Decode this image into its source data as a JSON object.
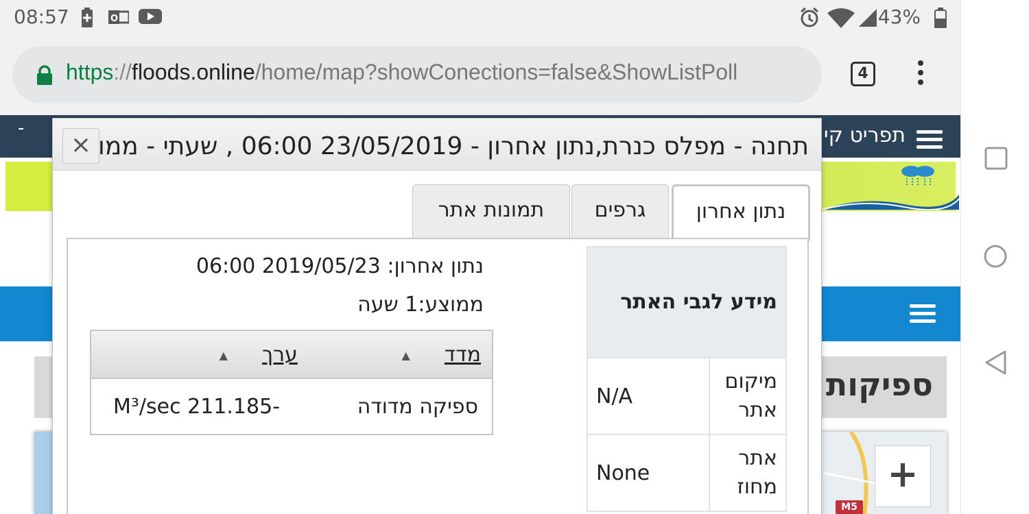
{
  "status_bar": {
    "time": "08:57",
    "battery": "43%",
    "icons": [
      "battery-saver-icon",
      "outlook-icon",
      "youtube-icon",
      "alarm-icon",
      "wifi-icon",
      "signal-icon",
      "battery-icon"
    ]
  },
  "browser": {
    "url_scheme": "https",
    "url_sep": "://",
    "url_host": "floods.online",
    "url_path": "/home/map?showConections=false&ShowListPoll",
    "tab_count": "4"
  },
  "site": {
    "menu_label": "תפריט קי",
    "dash": "-",
    "section_heading": "ספיקות",
    "map_zoom_in": "+",
    "map_road_badge": "M5"
  },
  "dialog": {
    "title": "תחנה - מפלס כנרת,נתון אחרון - 23/05/2019 06:00 , שעתי - ממו",
    "close": "×",
    "tabs": [
      {
        "label": "נתון אחרון",
        "active": true
      },
      {
        "label": "גרפים",
        "active": false
      },
      {
        "label": "תמונות אתר",
        "active": false
      }
    ],
    "site_info": {
      "header": "מידע לגבי האתר",
      "rows": [
        {
          "label": "מיקום אתר",
          "value": "N/A"
        },
        {
          "label": "אתר מחוז",
          "value": "None"
        }
      ]
    },
    "last_data_line": "נתון אחרון: 2019/05/23 06:00",
    "average_line": "ממוצע:1 שעה",
    "table": {
      "headers": {
        "measure": "מדד",
        "value": "ערך",
        "sort_glyph": "▲"
      },
      "rows": [
        {
          "measure": "ספיקה מדודה",
          "value": "M³/sec 211.185-"
        }
      ]
    }
  }
}
